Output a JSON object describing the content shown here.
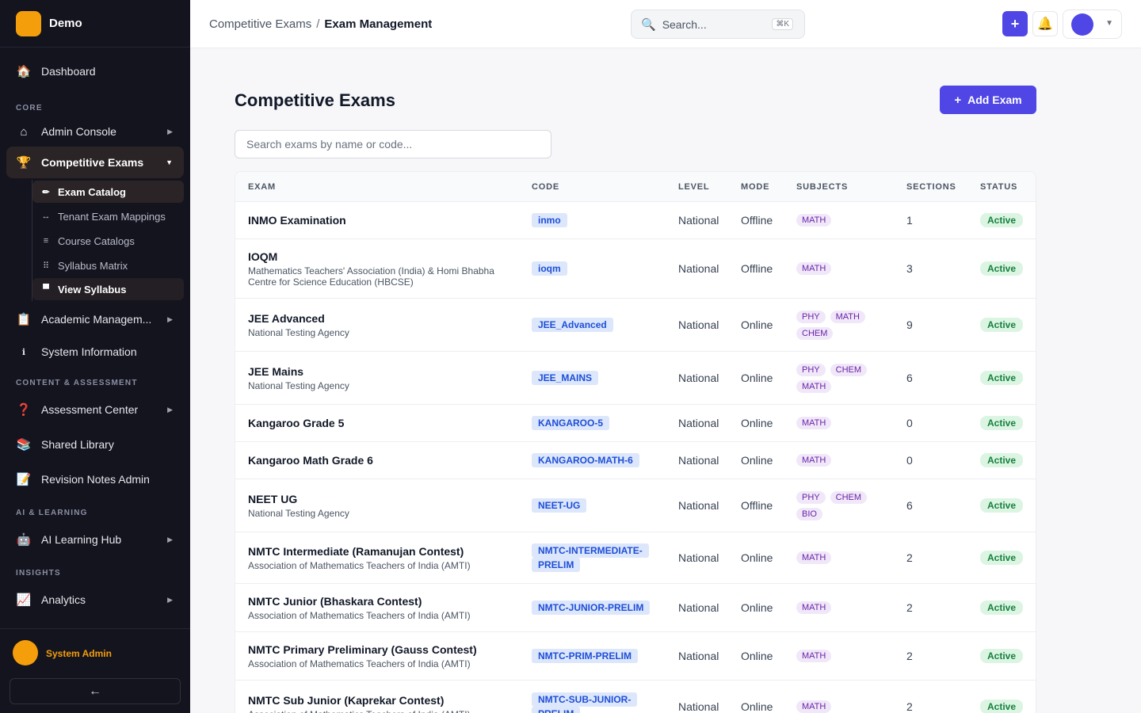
{
  "brand": {
    "name": "Demo"
  },
  "sidebar": {
    "dashboard": "Dashboard",
    "sections": {
      "core": "CORE",
      "content": "CONTENT & ASSESSMENT",
      "ai": "AI & LEARNING",
      "insights": "INSIGHTS"
    },
    "admin_console": "Admin Console",
    "competitive_exams": "Competitive Exams",
    "sub_items": [
      "Exam Catalog",
      "Tenant Exam Mappings",
      "Course Catalogs",
      "Syllabus Matrix",
      "View Syllabus"
    ],
    "academic_management": "Academic Managem...",
    "system_information": "System Information",
    "assessment_center": "Assessment Center",
    "shared_library": "Shared Library",
    "revision_notes_admin": "Revision Notes Admin",
    "ai_learning_hub": "AI Learning Hub",
    "analytics": "Analytics",
    "user_name": "System Admin",
    "collapse_icon": "←"
  },
  "topbar": {
    "breadcrumb": {
      "parent": "Competitive Exams",
      "separator": "/",
      "current": "Exam Management"
    },
    "search_placeholder": "Search...",
    "search_shortcut": "⌘K",
    "plus_icon": "+",
    "bell_icon": "🔔",
    "profile_chevron": "▼"
  },
  "page": {
    "title": "Competitive Exams",
    "add_button": "Add Exam",
    "add_icon": "+",
    "filter_placeholder": "Search exams by name or code..."
  },
  "table": {
    "headers": [
      "EXAM",
      "CODE",
      "LEVEL",
      "MODE",
      "SUBJECTS",
      "SECTIONS",
      "STATUS"
    ],
    "rows": [
      {
        "name": "INMO Examination",
        "org": "",
        "code": "inmo",
        "level": "National",
        "mode": "Offline",
        "subjects": [
          "MATH"
        ],
        "sections": "1",
        "status": "Active"
      },
      {
        "name": "IOQM",
        "org": "Mathematics Teachers' Association (India) & Homi Bhabha Centre for Science Education (HBCSE)",
        "code": "ioqm",
        "level": "National",
        "mode": "Offline",
        "subjects": [
          "MATH"
        ],
        "sections": "3",
        "status": "Active"
      },
      {
        "name": "JEE Advanced",
        "org": "National Testing Agency",
        "code": "JEE_Advanced",
        "level": "National",
        "mode": "Online",
        "subjects": [
          "PHY",
          "MATH",
          "CHEM"
        ],
        "sections": "9",
        "status": "Active"
      },
      {
        "name": "JEE Mains",
        "org": "National Testing Agency",
        "code": "JEE_MAINS",
        "level": "National",
        "mode": "Online",
        "subjects": [
          "PHY",
          "CHEM",
          "MATH"
        ],
        "sections": "6",
        "status": "Active"
      },
      {
        "name": "Kangaroo Grade 5",
        "org": "",
        "code": "KANGAROO-5",
        "level": "National",
        "mode": "Online",
        "subjects": [
          "MATH"
        ],
        "sections": "0",
        "status": "Active"
      },
      {
        "name": "Kangaroo Math Grade 6",
        "org": "",
        "code": "KANGAROO-MATH-6",
        "level": "National",
        "mode": "Online",
        "subjects": [
          "MATH"
        ],
        "sections": "0",
        "status": "Active"
      },
      {
        "name": "NEET UG",
        "org": "National Testing Agency",
        "code": "NEET-UG",
        "level": "National",
        "mode": "Offline",
        "subjects": [
          "PHY",
          "CHEM",
          "BIO"
        ],
        "sections": "6",
        "status": "Active"
      },
      {
        "name": "NMTC Intermediate (Ramanujan Contest)",
        "org": "Association of Mathematics Teachers of India (AMTI)",
        "code": "NMTC-INTERMEDIATE-PRELIM",
        "level": "National",
        "mode": "Online",
        "subjects": [
          "MATH"
        ],
        "sections": "2",
        "status": "Active"
      },
      {
        "name": "NMTC Junior (Bhaskara Contest)",
        "org": "Association of Mathematics Teachers of India (AMTI)",
        "code": "NMTC-JUNIOR-PRELIM",
        "level": "National",
        "mode": "Online",
        "subjects": [
          "MATH"
        ],
        "sections": "2",
        "status": "Active"
      },
      {
        "name": "NMTC Primary Preliminary (Gauss Contest)",
        "org": "Association of Mathematics Teachers of India (AMTI)",
        "code": "NMTC-PRIM-PRELIM",
        "level": "National",
        "mode": "Online",
        "subjects": [
          "MATH"
        ],
        "sections": "2",
        "status": "Active"
      },
      {
        "name": "NMTC Sub Junior (Kaprekar Contest)",
        "org": "Association of Mathematics Teachers of India (AMTI)",
        "code": "NMTC-SUB-JUNIOR-PRELIM",
        "level": "National",
        "mode": "Online",
        "subjects": [
          "MATH"
        ],
        "sections": "2",
        "status": "Active"
      }
    ]
  }
}
